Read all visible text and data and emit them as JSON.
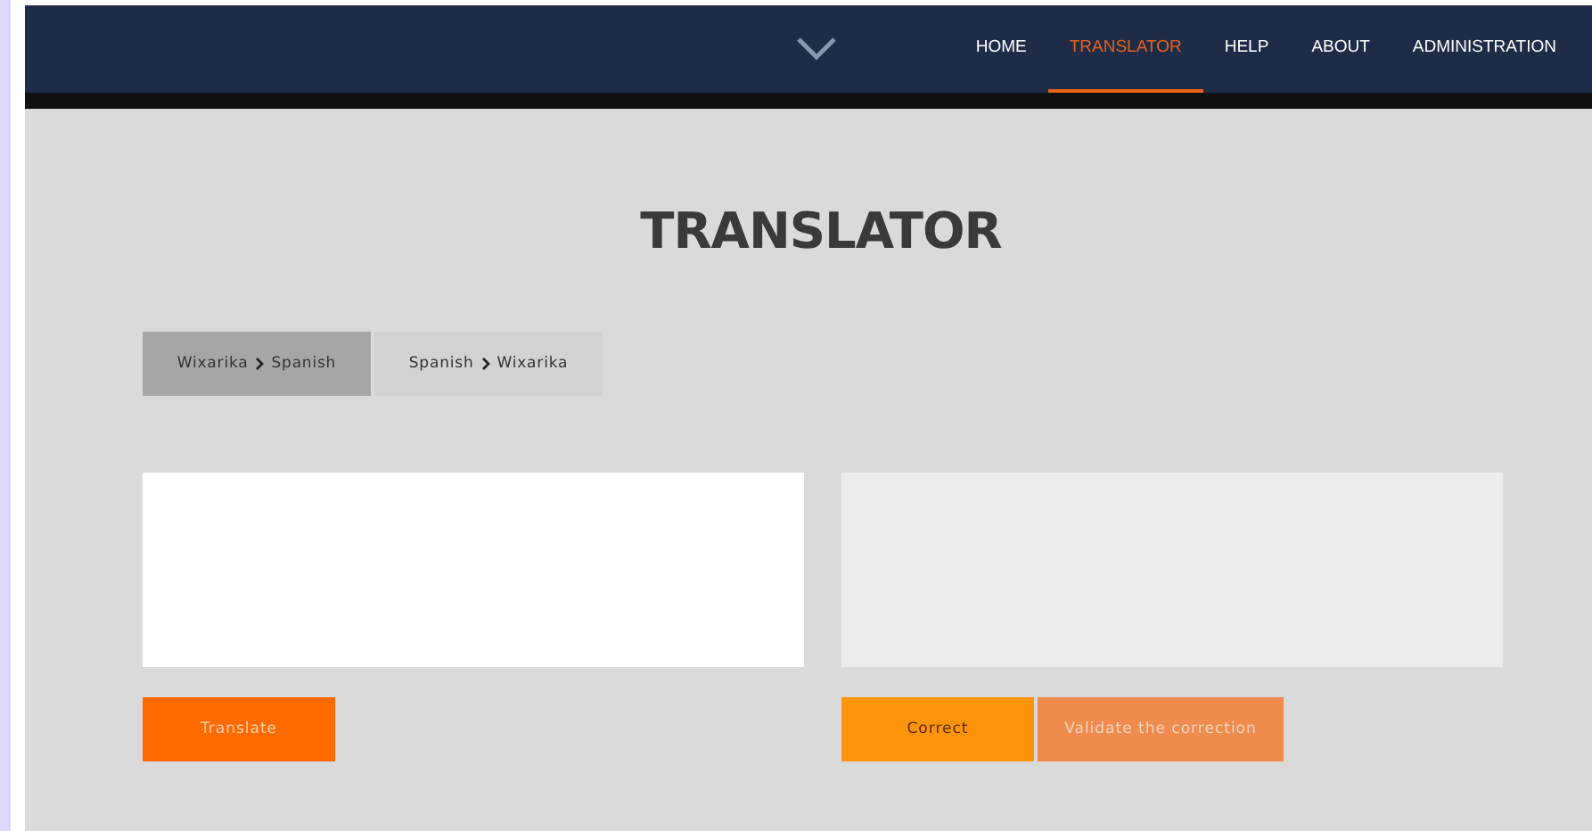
{
  "nav": [
    {
      "label": "HOME",
      "selected": false
    },
    {
      "label": "TRANSLATOR",
      "selected": true
    },
    {
      "label": "HELP",
      "selected": false
    },
    {
      "label": "ABOUT",
      "selected": false
    },
    {
      "label": "ADMINISTRATION",
      "selected": false
    }
  ],
  "title": "TRANSLATOR",
  "directions": [
    {
      "from": "Wixarika",
      "to": "Spanish",
      "selected": true
    },
    {
      "from": "Spanish",
      "to": "Wixarika",
      "selected": false
    }
  ],
  "source_field": {
    "disabled": false
  },
  "target_field": {
    "disabled": true
  },
  "translate_button": "Translate",
  "correction_buttons": [
    {
      "label": "Correct",
      "kind": "primary"
    },
    {
      "label": "Validate the correction",
      "kind": "secondary"
    }
  ]
}
